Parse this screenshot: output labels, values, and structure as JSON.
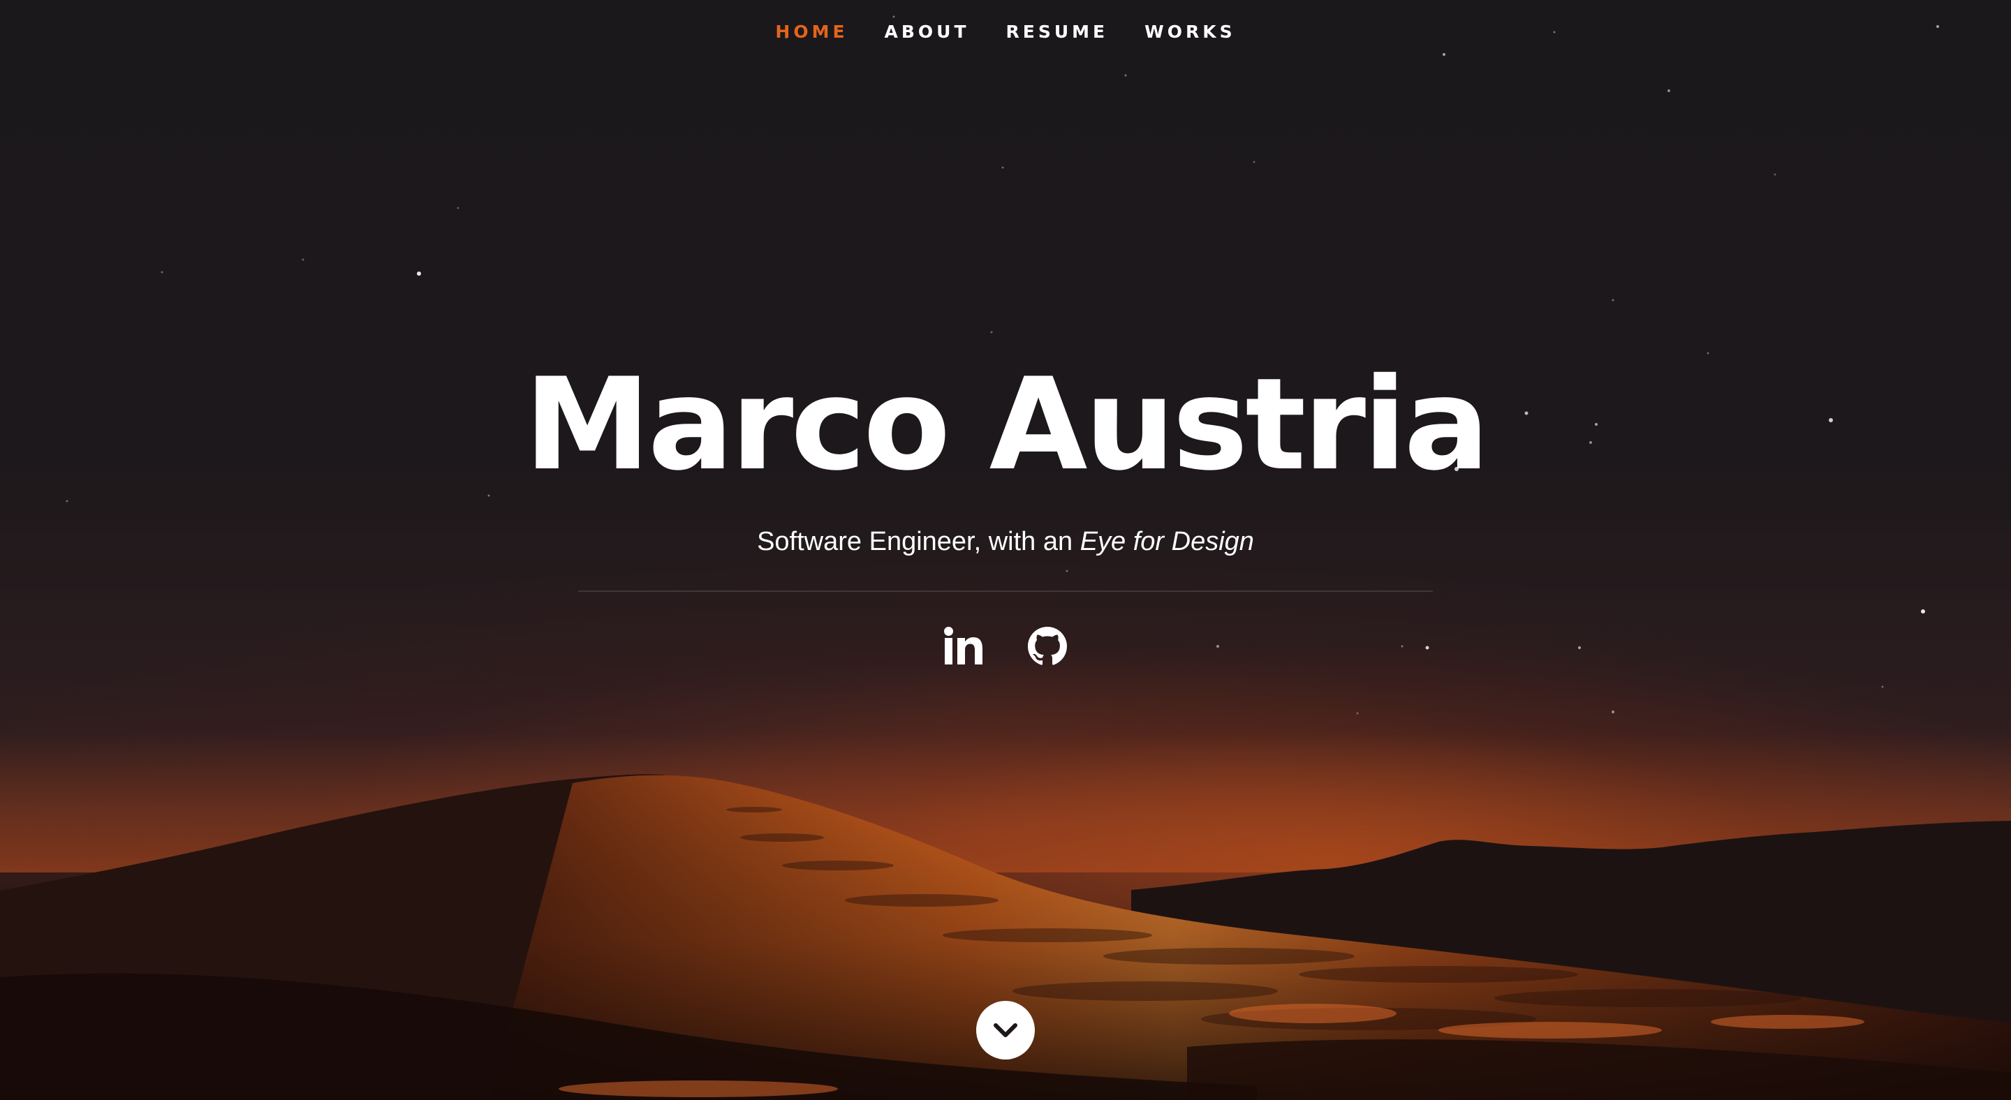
{
  "nav": {
    "items": [
      {
        "label": "HOME",
        "active": true
      },
      {
        "label": "ABOUT",
        "active": false
      },
      {
        "label": "RESUME",
        "active": false
      },
      {
        "label": "WORKS",
        "active": false
      }
    ],
    "active_color": "#e3641d"
  },
  "hero": {
    "name": "Marco Austria",
    "tagline_prefix": "Software Engineer, with an ",
    "tagline_emphasis": "Eye for Design"
  },
  "social": {
    "icons": [
      "linkedin-icon",
      "github-icon"
    ]
  },
  "scroll_button": {
    "icon": "chevron-down-icon"
  }
}
